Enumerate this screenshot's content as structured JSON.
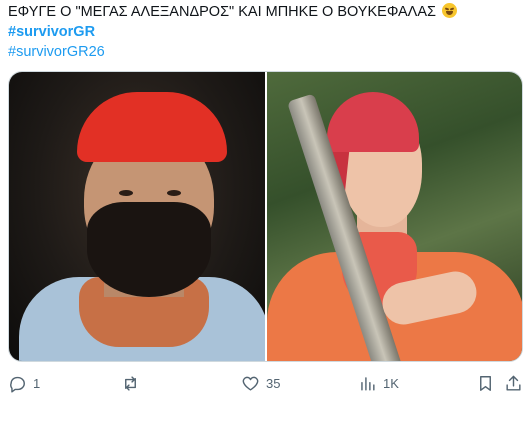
{
  "tweet": {
    "text": "ΕΦΥΓΕ Ο \"ΜΕΓΑΣ ΑΛΕΞΑΝΔΡΟΣ\" ΚΑΙ ΜΠΗΚΕ Ο ΒΟΥΚΕΦΑΛΑΣ",
    "emoji_icon": "rolling-on-floor-laughing-emoji",
    "hashtags": [
      "#survivorGR",
      "#survivorGR26"
    ]
  },
  "media": {
    "photos": [
      {
        "name": "photo-bearded-man-red-bandana"
      },
      {
        "name": "photo-man-holding-stick-orange-shirt"
      }
    ]
  },
  "actions": {
    "reply": {
      "icon": "reply-icon",
      "count": "1"
    },
    "repost": {
      "icon": "repost-icon",
      "count": ""
    },
    "like": {
      "icon": "heart-icon",
      "count": "35"
    },
    "views": {
      "icon": "views-icon",
      "count": "1K"
    },
    "bookmark": {
      "icon": "bookmark-icon"
    },
    "share": {
      "icon": "share-icon"
    }
  },
  "colors": {
    "hashtag": "#1d9bf0",
    "text": "#0f1419",
    "muted": "#536471"
  }
}
